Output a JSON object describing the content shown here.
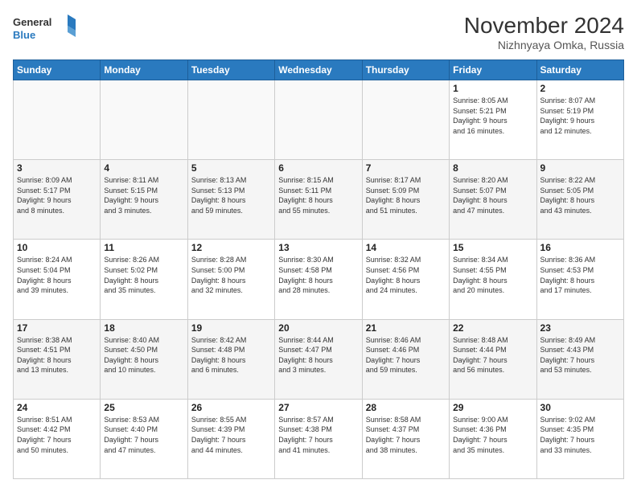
{
  "header": {
    "logo_line1": "General",
    "logo_line2": "Blue",
    "main_title": "November 2024",
    "subtitle": "Nizhnyaya Omka, Russia"
  },
  "columns": [
    "Sunday",
    "Monday",
    "Tuesday",
    "Wednesday",
    "Thursday",
    "Friday",
    "Saturday"
  ],
  "weeks": [
    [
      {
        "day": "",
        "info": ""
      },
      {
        "day": "",
        "info": ""
      },
      {
        "day": "",
        "info": ""
      },
      {
        "day": "",
        "info": ""
      },
      {
        "day": "",
        "info": ""
      },
      {
        "day": "1",
        "info": "Sunrise: 8:05 AM\nSunset: 5:21 PM\nDaylight: 9 hours\nand 16 minutes."
      },
      {
        "day": "2",
        "info": "Sunrise: 8:07 AM\nSunset: 5:19 PM\nDaylight: 9 hours\nand 12 minutes."
      }
    ],
    [
      {
        "day": "3",
        "info": "Sunrise: 8:09 AM\nSunset: 5:17 PM\nDaylight: 9 hours\nand 8 minutes."
      },
      {
        "day": "4",
        "info": "Sunrise: 8:11 AM\nSunset: 5:15 PM\nDaylight: 9 hours\nand 3 minutes."
      },
      {
        "day": "5",
        "info": "Sunrise: 8:13 AM\nSunset: 5:13 PM\nDaylight: 8 hours\nand 59 minutes."
      },
      {
        "day": "6",
        "info": "Sunrise: 8:15 AM\nSunset: 5:11 PM\nDaylight: 8 hours\nand 55 minutes."
      },
      {
        "day": "7",
        "info": "Sunrise: 8:17 AM\nSunset: 5:09 PM\nDaylight: 8 hours\nand 51 minutes."
      },
      {
        "day": "8",
        "info": "Sunrise: 8:20 AM\nSunset: 5:07 PM\nDaylight: 8 hours\nand 47 minutes."
      },
      {
        "day": "9",
        "info": "Sunrise: 8:22 AM\nSunset: 5:05 PM\nDaylight: 8 hours\nand 43 minutes."
      }
    ],
    [
      {
        "day": "10",
        "info": "Sunrise: 8:24 AM\nSunset: 5:04 PM\nDaylight: 8 hours\nand 39 minutes."
      },
      {
        "day": "11",
        "info": "Sunrise: 8:26 AM\nSunset: 5:02 PM\nDaylight: 8 hours\nand 35 minutes."
      },
      {
        "day": "12",
        "info": "Sunrise: 8:28 AM\nSunset: 5:00 PM\nDaylight: 8 hours\nand 32 minutes."
      },
      {
        "day": "13",
        "info": "Sunrise: 8:30 AM\nSunset: 4:58 PM\nDaylight: 8 hours\nand 28 minutes."
      },
      {
        "day": "14",
        "info": "Sunrise: 8:32 AM\nSunset: 4:56 PM\nDaylight: 8 hours\nand 24 minutes."
      },
      {
        "day": "15",
        "info": "Sunrise: 8:34 AM\nSunset: 4:55 PM\nDaylight: 8 hours\nand 20 minutes."
      },
      {
        "day": "16",
        "info": "Sunrise: 8:36 AM\nSunset: 4:53 PM\nDaylight: 8 hours\nand 17 minutes."
      }
    ],
    [
      {
        "day": "17",
        "info": "Sunrise: 8:38 AM\nSunset: 4:51 PM\nDaylight: 8 hours\nand 13 minutes."
      },
      {
        "day": "18",
        "info": "Sunrise: 8:40 AM\nSunset: 4:50 PM\nDaylight: 8 hours\nand 10 minutes."
      },
      {
        "day": "19",
        "info": "Sunrise: 8:42 AM\nSunset: 4:48 PM\nDaylight: 8 hours\nand 6 minutes."
      },
      {
        "day": "20",
        "info": "Sunrise: 8:44 AM\nSunset: 4:47 PM\nDaylight: 8 hours\nand 3 minutes."
      },
      {
        "day": "21",
        "info": "Sunrise: 8:46 AM\nSunset: 4:46 PM\nDaylight: 7 hours\nand 59 minutes."
      },
      {
        "day": "22",
        "info": "Sunrise: 8:48 AM\nSunset: 4:44 PM\nDaylight: 7 hours\nand 56 minutes."
      },
      {
        "day": "23",
        "info": "Sunrise: 8:49 AM\nSunset: 4:43 PM\nDaylight: 7 hours\nand 53 minutes."
      }
    ],
    [
      {
        "day": "24",
        "info": "Sunrise: 8:51 AM\nSunset: 4:42 PM\nDaylight: 7 hours\nand 50 minutes."
      },
      {
        "day": "25",
        "info": "Sunrise: 8:53 AM\nSunset: 4:40 PM\nDaylight: 7 hours\nand 47 minutes."
      },
      {
        "day": "26",
        "info": "Sunrise: 8:55 AM\nSunset: 4:39 PM\nDaylight: 7 hours\nand 44 minutes."
      },
      {
        "day": "27",
        "info": "Sunrise: 8:57 AM\nSunset: 4:38 PM\nDaylight: 7 hours\nand 41 minutes."
      },
      {
        "day": "28",
        "info": "Sunrise: 8:58 AM\nSunset: 4:37 PM\nDaylight: 7 hours\nand 38 minutes."
      },
      {
        "day": "29",
        "info": "Sunrise: 9:00 AM\nSunset: 4:36 PM\nDaylight: 7 hours\nand 35 minutes."
      },
      {
        "day": "30",
        "info": "Sunrise: 9:02 AM\nSunset: 4:35 PM\nDaylight: 7 hours\nand 33 minutes."
      }
    ]
  ]
}
